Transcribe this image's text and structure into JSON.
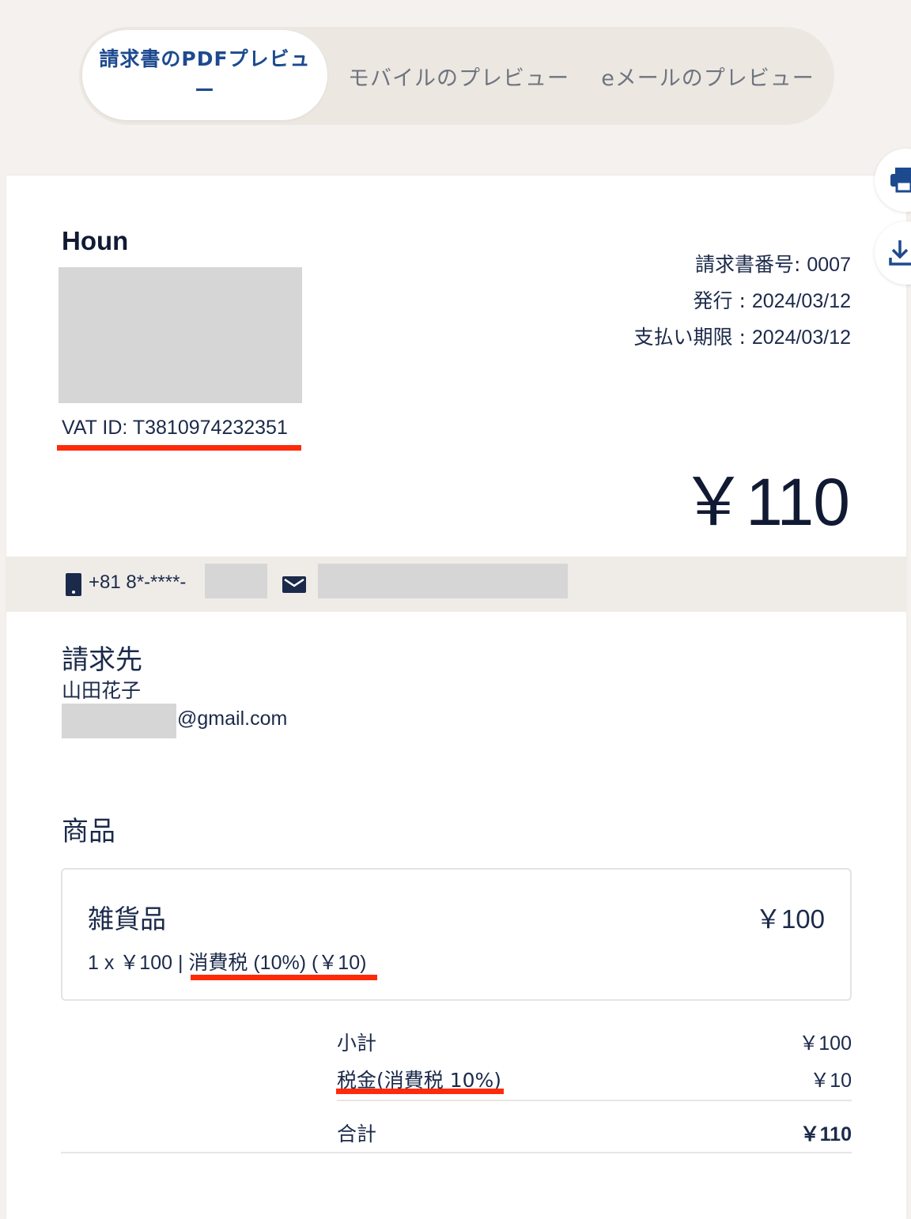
{
  "tabs": [
    {
      "label_line1": "請求書のPDFプレビュ",
      "label_line2": "ー"
    },
    {
      "label": "モバイルのプレビュー"
    },
    {
      "label": "eメールのプレビュー"
    }
  ],
  "side_actions": {
    "print_icon": "printer-icon",
    "download_icon": "download-icon"
  },
  "invoice": {
    "company": "Houn",
    "vat_id": "VAT ID: T3810974232351",
    "number_label": "請求書番号:",
    "number": "0007",
    "issued_label": "発行 :",
    "issued": "2024/03/12",
    "due_label": "支払い期限 :",
    "due": "2024/03/12",
    "total_amount": "￥110"
  },
  "contact": {
    "phone": "+81 8*-****-",
    "phone_icon": "phone-icon",
    "mail_icon": "mail-icon"
  },
  "bill_to": {
    "heading": "請求先",
    "name": "山田花子",
    "email_suffix": "@gmail.com"
  },
  "items_section": {
    "heading": "商品",
    "items": [
      {
        "name": "雑貨品",
        "price": "￥100",
        "qty_price": "1 x ￥100 | ",
        "tax_note": "消費税 (10%) (￥10)"
      }
    ]
  },
  "summary": {
    "subtotal_label": "小計",
    "subtotal": "￥100",
    "tax_label": "税金(消費税 10%)",
    "tax": "￥10",
    "total_label": "合計",
    "total": "￥110"
  },
  "colors": {
    "accent": "#1d4a8f",
    "highlight_underline": "#ff2a0a",
    "text": "#1b2a4a"
  }
}
